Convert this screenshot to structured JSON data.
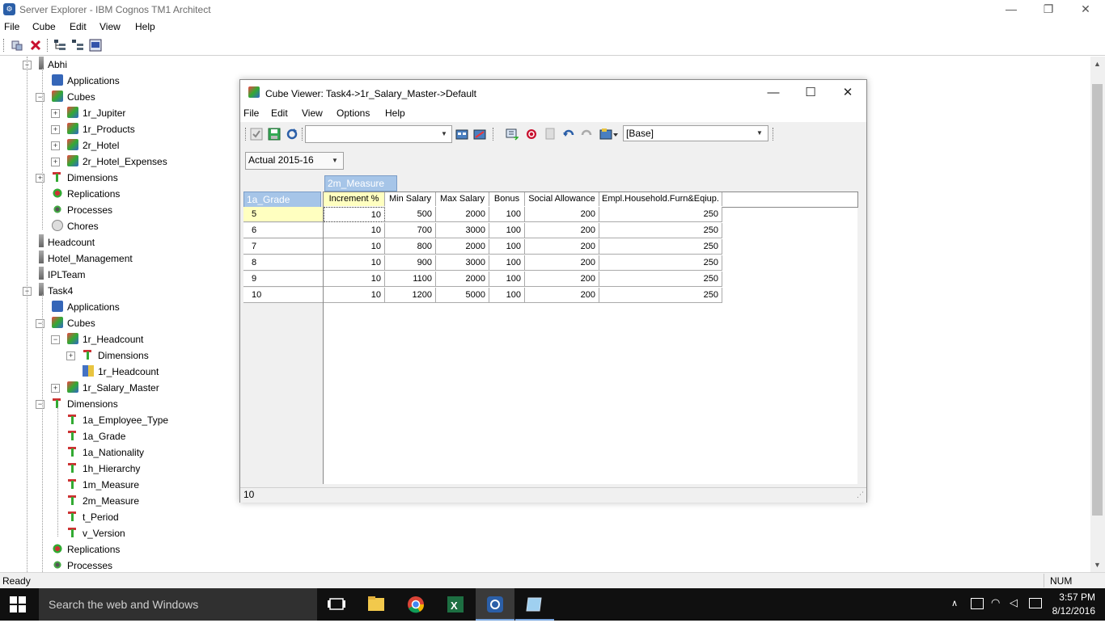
{
  "app": {
    "title": "Server Explorer - IBM Cognos TM1 Architect"
  },
  "menubar": [
    "File",
    "Cube",
    "Edit",
    "View",
    "Help"
  ],
  "tree": [
    {
      "label": "Abhi",
      "icon": "server-icon",
      "level": 0
    },
    {
      "label": "Applications",
      "icon": "applications-icon",
      "level": 1
    },
    {
      "label": "Cubes",
      "icon": "cubes-icon",
      "level": 1
    },
    {
      "label": "1r_Jupiter",
      "icon": "cube-icon",
      "level": 2
    },
    {
      "label": "1r_Products",
      "icon": "cube-icon",
      "level": 2
    },
    {
      "label": "2r_Hotel",
      "icon": "cube-icon",
      "level": 2
    },
    {
      "label": "2r_Hotel_Expenses",
      "icon": "cube-icon",
      "level": 2
    },
    {
      "label": "Dimensions",
      "icon": "dimensions-icon",
      "level": 1
    },
    {
      "label": "Replications",
      "icon": "replications-icon",
      "level": 1
    },
    {
      "label": "Processes",
      "icon": "processes-icon",
      "level": 1
    },
    {
      "label": "Chores",
      "icon": "chores-icon",
      "level": 1
    },
    {
      "label": "Headcount",
      "icon": "server-icon",
      "level": 0
    },
    {
      "label": "Hotel_Management",
      "icon": "server-icon",
      "level": 0
    },
    {
      "label": "IPLTeam",
      "icon": "server-icon",
      "level": 0
    },
    {
      "label": "Task4",
      "icon": "server-icon",
      "level": 0
    },
    {
      "label": "Applications",
      "icon": "applications-icon",
      "level": 1
    },
    {
      "label": "Cubes",
      "icon": "cubes-icon",
      "level": 1
    },
    {
      "label": "1r_Headcount",
      "icon": "cube-icon",
      "level": 2
    },
    {
      "label": "Dimensions",
      "icon": "dimensions-icon",
      "level": 3
    },
    {
      "label": "1r_Headcount",
      "icon": "view-icon",
      "level": 3
    },
    {
      "label": "1r_Salary_Master",
      "icon": "cube-icon",
      "level": 2
    },
    {
      "label": "Dimensions",
      "icon": "dimensions-icon",
      "level": 1
    },
    {
      "label": "1a_Employee_Type",
      "icon": "dimension-icon",
      "level": 2
    },
    {
      "label": "1a_Grade",
      "icon": "dimension-icon",
      "level": 2
    },
    {
      "label": "1a_Nationality",
      "icon": "dimension-icon",
      "level": 2
    },
    {
      "label": "1h_Hierarchy",
      "icon": "dimension-icon",
      "level": 2
    },
    {
      "label": "1m_Measure",
      "icon": "dimension-icon",
      "level": 2
    },
    {
      "label": "2m_Measure",
      "icon": "dimension-icon",
      "level": 2
    },
    {
      "label": "t_Period",
      "icon": "dimension-icon",
      "level": 2
    },
    {
      "label": "v_Version",
      "icon": "dimension-icon",
      "level": 2
    },
    {
      "label": "Replications",
      "icon": "replications-icon",
      "level": 1
    },
    {
      "label": "Processes",
      "icon": "processes-icon",
      "level": 1
    }
  ],
  "status": {
    "text": "Ready",
    "num": "NUM"
  },
  "taskbar": {
    "search_placeholder": "Search the web and Windows",
    "time": "3:57 PM",
    "date": "8/12/2016"
  },
  "cube_viewer": {
    "title": "Cube Viewer: Task4->1r_Salary_Master->Default",
    "menu": [
      "File",
      "Edit",
      "View",
      "Options",
      "Help"
    ],
    "subset_value": "",
    "view_value": "[Base]",
    "title_dimension_value": "Actual 2015-16",
    "column_dimension": "2m_Measure",
    "row_dimension": "1a_Grade",
    "columns": [
      "Increment %",
      "Min Salary",
      "Max Salary",
      "Bonus",
      "Social Allowance",
      "Empl.Household.Furn&Eqiup."
    ],
    "rows": [
      {
        "label": "5",
        "values": [
          "10",
          "500",
          "2000",
          "100",
          "200",
          "250"
        ]
      },
      {
        "label": "6",
        "values": [
          "10",
          "700",
          "3000",
          "100",
          "200",
          "250"
        ]
      },
      {
        "label": "7",
        "values": [
          "10",
          "800",
          "2000",
          "100",
          "200",
          "250"
        ]
      },
      {
        "label": "8",
        "values": [
          "10",
          "900",
          "3000",
          "100",
          "200",
          "250"
        ]
      },
      {
        "label": "9",
        "values": [
          "10",
          "1100",
          "2000",
          "100",
          "200",
          "250"
        ]
      },
      {
        "label": "10",
        "values": [
          "10",
          "1200",
          "5000",
          "100",
          "200",
          "250"
        ]
      }
    ],
    "status_value": "10"
  }
}
